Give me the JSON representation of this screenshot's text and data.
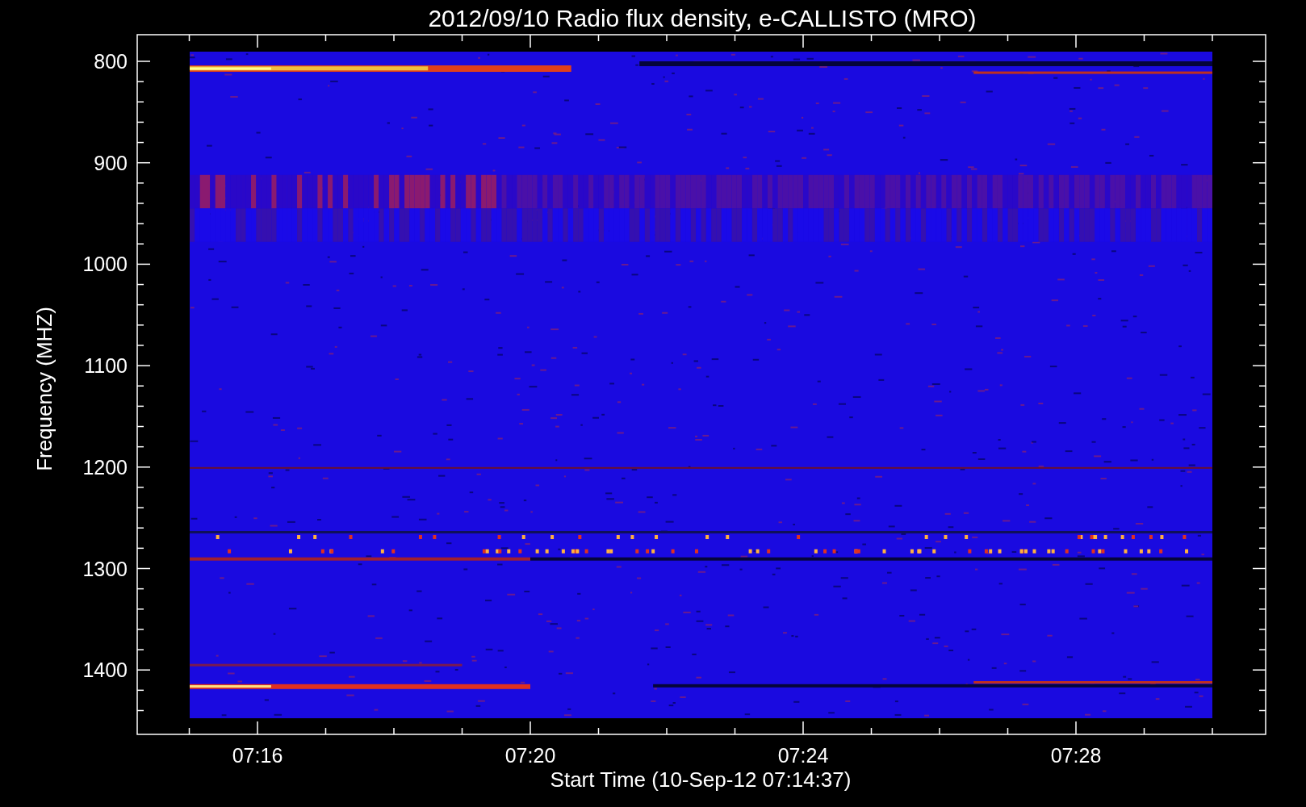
{
  "plot": {
    "title": "2012/09/10  Radio flux density, e-CALLISTO (MRO)",
    "ylabel": "Frequency (MHZ)",
    "xlabel": "Start Time (10-Sep-12 07:14:37)",
    "yticks": [
      "800",
      "900",
      "1000",
      "1100",
      "1200",
      "1300",
      "1400"
    ],
    "xticks": [
      "07:16",
      "07:20",
      "07:24",
      "07:28"
    ]
  }
}
